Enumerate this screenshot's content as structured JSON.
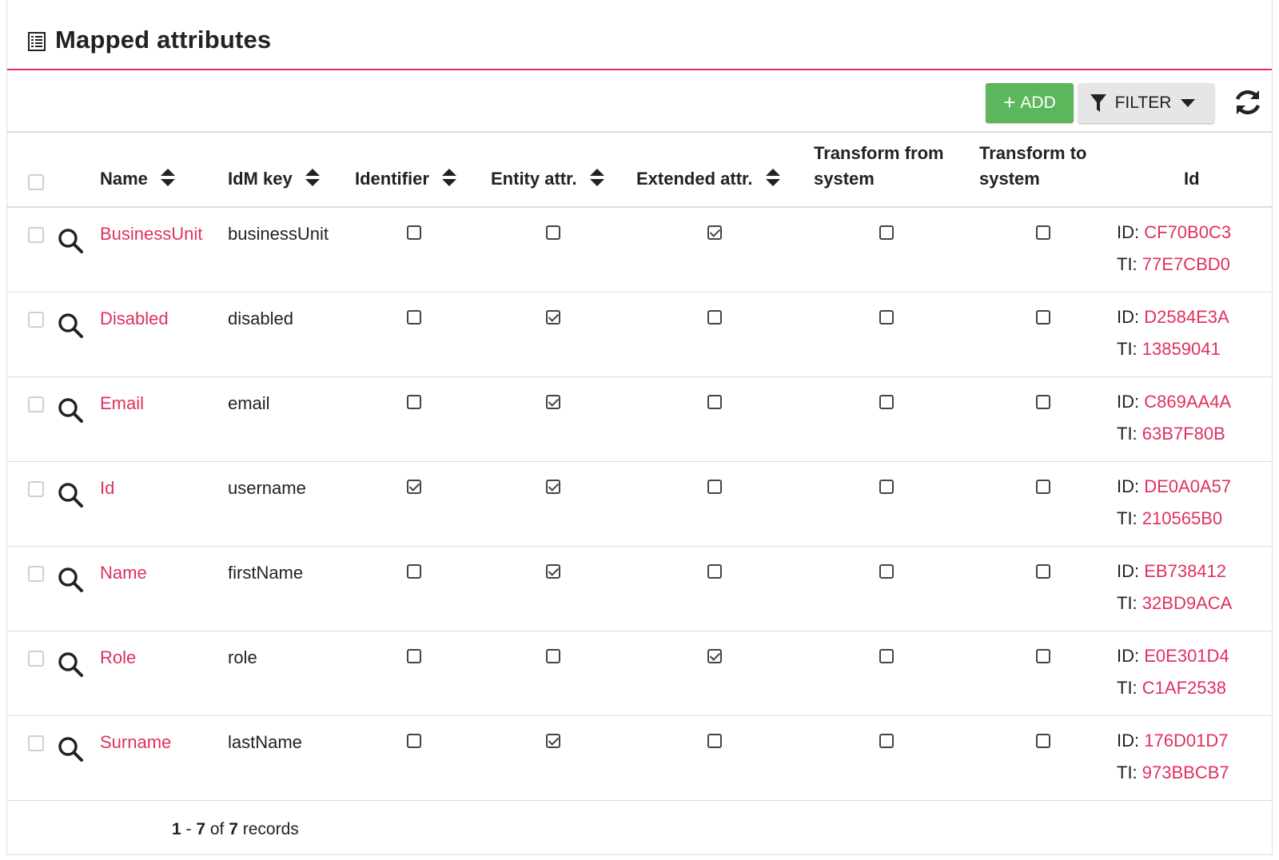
{
  "header": {
    "title": "Mapped attributes",
    "icon": "list-icon"
  },
  "toolbar": {
    "add_label": "ADD",
    "filter_label": "FILTER",
    "refresh_icon": "refresh-icon"
  },
  "colors": {
    "accent": "#e0315d",
    "add_button": "#5cb65c",
    "filter_button": "#e6e6e6"
  },
  "columns": {
    "name": "Name",
    "idm_key": "IdM key",
    "identifier": "Identifier",
    "entity_attr": "Entity attr.",
    "extended_attr": "Extended attr.",
    "transform_from_1": "Transform from",
    "transform_from_2": "system",
    "transform_to_1": "Transform to",
    "transform_to_2": "system",
    "id": "Id"
  },
  "id_labels": {
    "id": "ID:",
    "ti": "TI:"
  },
  "rows": [
    {
      "name": "BusinessUnit",
      "idm_key": "businessUnit",
      "identifier": false,
      "entity_attr": false,
      "extended_attr": true,
      "transform_from": false,
      "transform_to": false,
      "id": "CF70B0C3",
      "ti": "77E7CBD0"
    },
    {
      "name": "Disabled",
      "idm_key": "disabled",
      "identifier": false,
      "entity_attr": true,
      "extended_attr": false,
      "transform_from": false,
      "transform_to": false,
      "id": "D2584E3A",
      "ti": "13859041"
    },
    {
      "name": "Email",
      "idm_key": "email",
      "identifier": false,
      "entity_attr": true,
      "extended_attr": false,
      "transform_from": false,
      "transform_to": false,
      "id": "C869AA4A",
      "ti": "63B7F80B"
    },
    {
      "name": "Id",
      "idm_key": "username",
      "identifier": true,
      "entity_attr": true,
      "extended_attr": false,
      "transform_from": false,
      "transform_to": false,
      "id": "DE0A0A57",
      "ti": "210565B0"
    },
    {
      "name": "Name",
      "idm_key": "firstName",
      "identifier": false,
      "entity_attr": true,
      "extended_attr": false,
      "transform_from": false,
      "transform_to": false,
      "id": "EB738412",
      "ti": "32BD9ACA"
    },
    {
      "name": "Role",
      "idm_key": "role",
      "identifier": false,
      "entity_attr": false,
      "extended_attr": true,
      "transform_from": false,
      "transform_to": false,
      "id": "E0E301D4",
      "ti": "C1AF2538"
    },
    {
      "name": "Surname",
      "idm_key": "lastName",
      "identifier": false,
      "entity_attr": true,
      "extended_attr": false,
      "transform_from": false,
      "transform_to": false,
      "id": "176D01D7",
      "ti": "973BBCB7"
    }
  ],
  "pagination": {
    "from": "1",
    "sep": " - ",
    "to": "7",
    "of": " of ",
    "total": "7",
    "suffix": " records"
  }
}
